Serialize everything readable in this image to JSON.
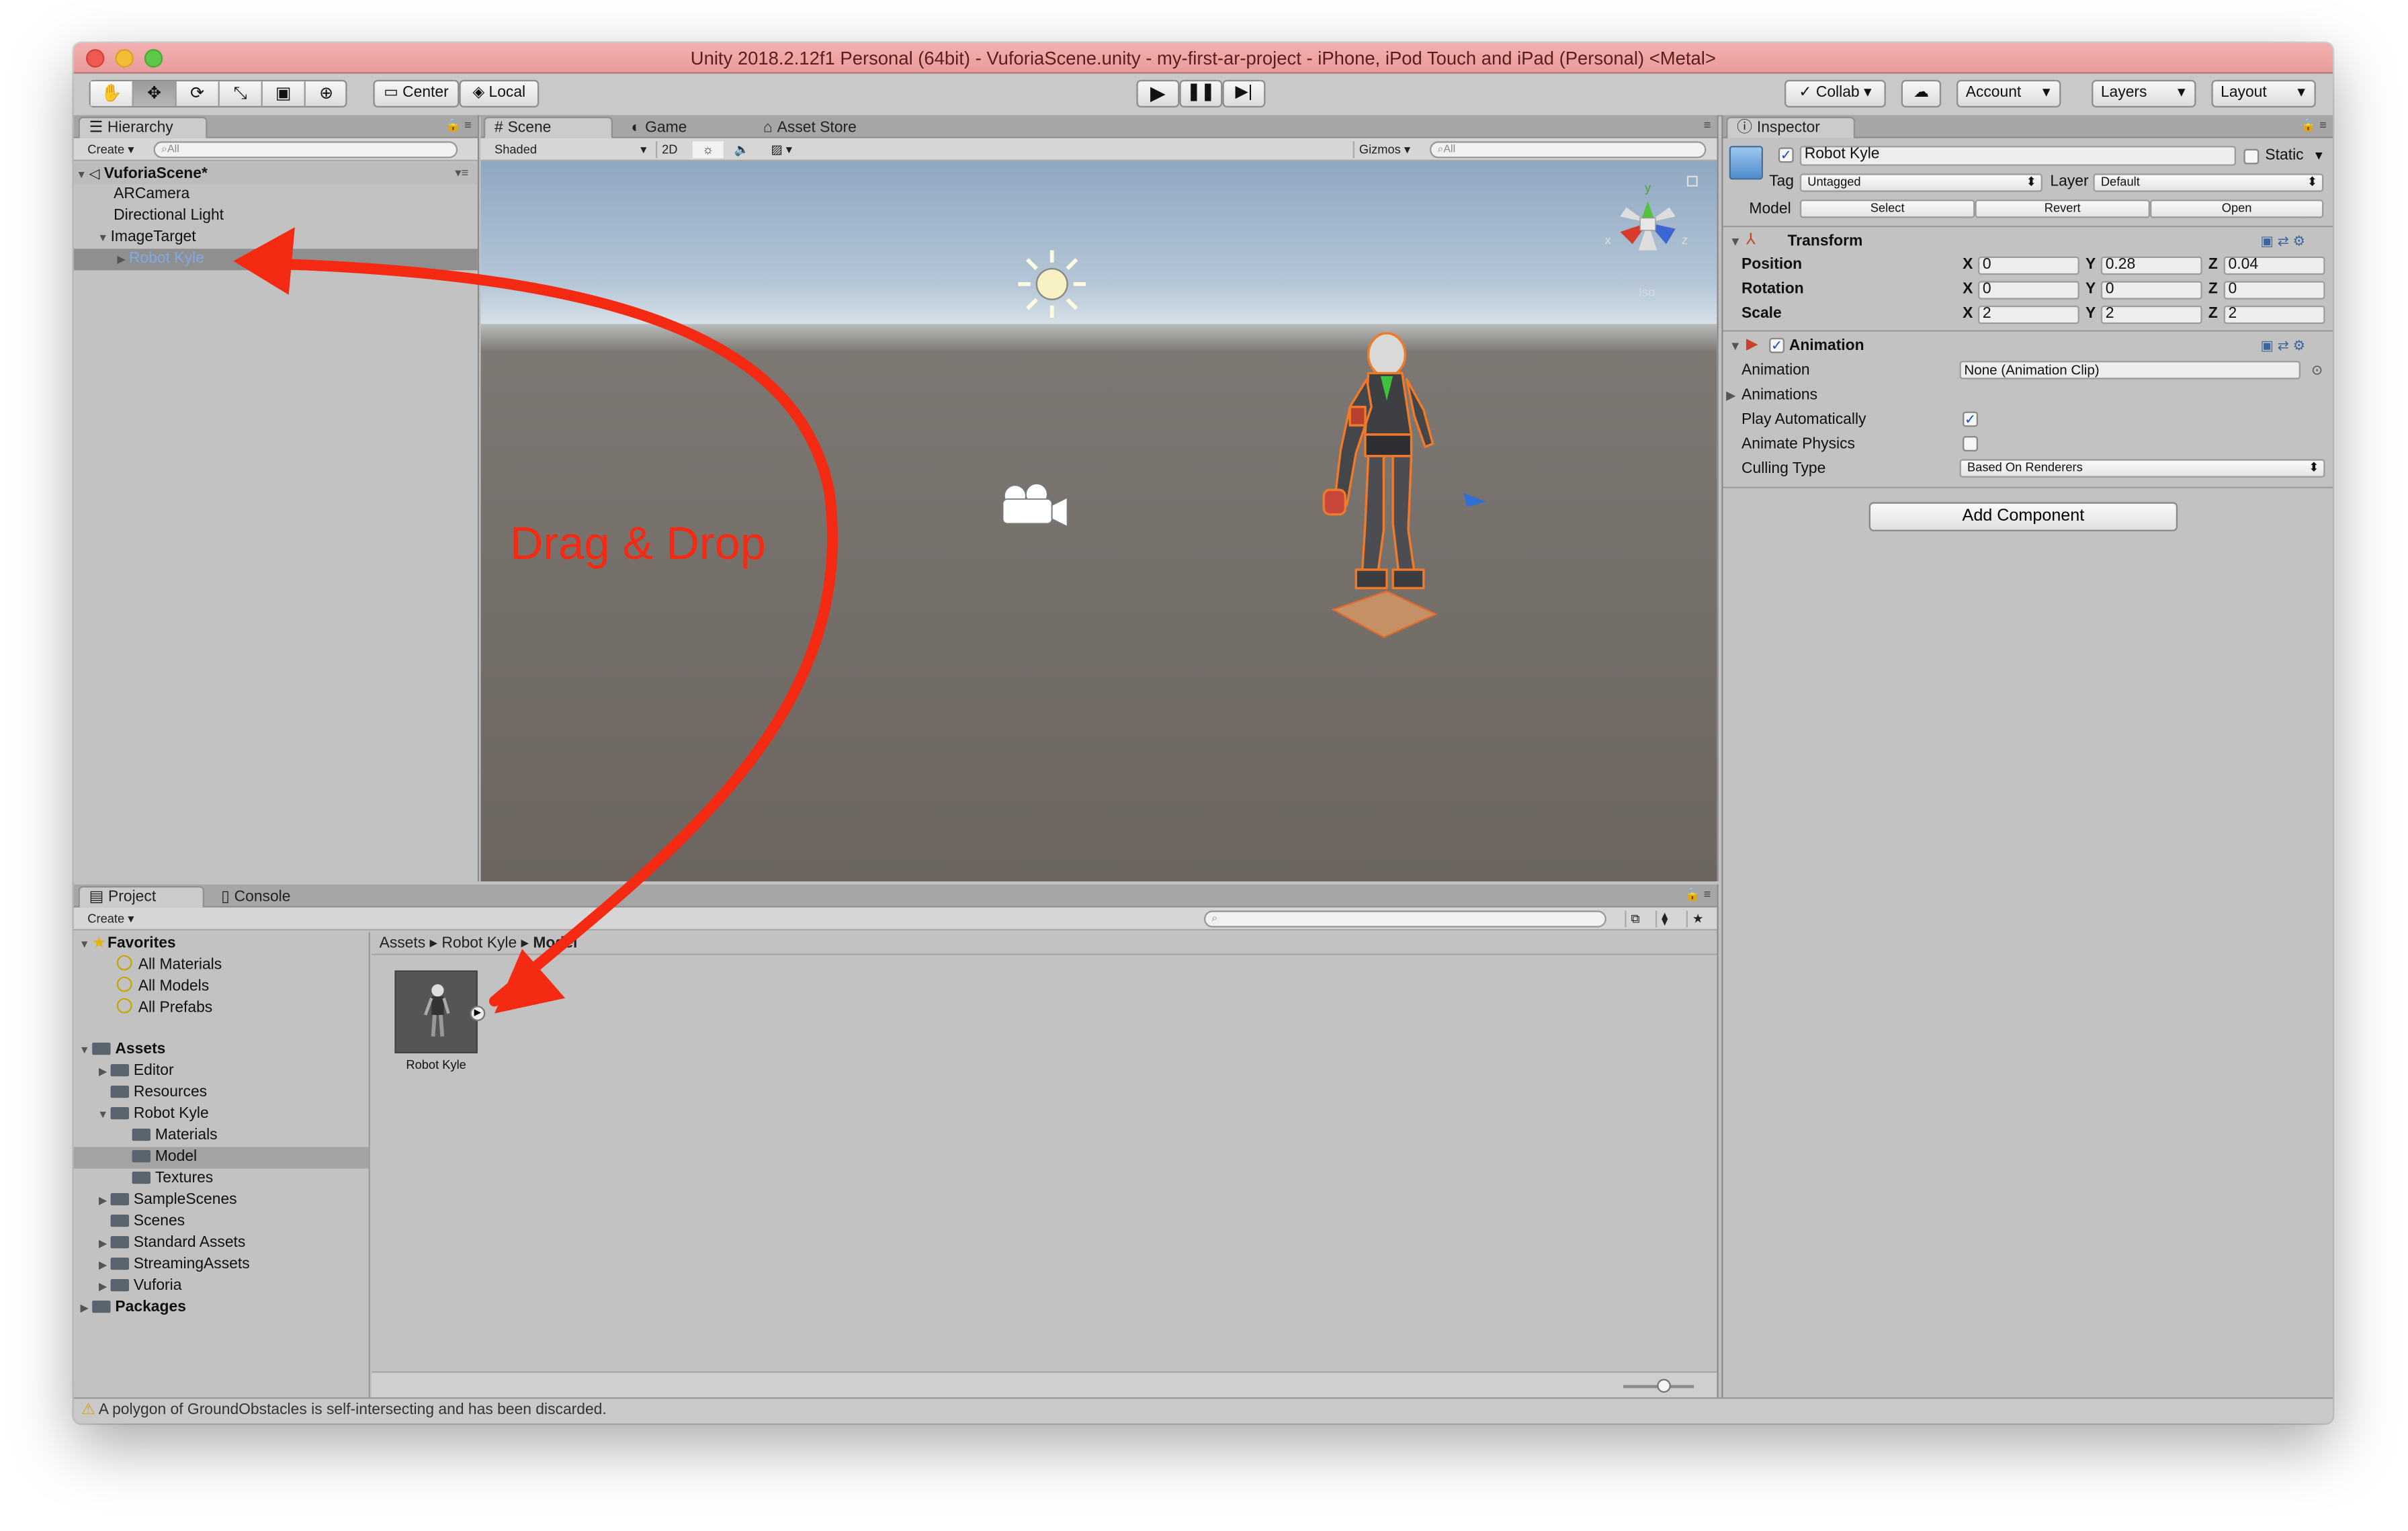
{
  "window": {
    "title": "Unity 2018.2.12f1 Personal (64bit) - VuforiaScene.unity - my-first-ar-project - iPhone, iPod Touch and iPad (Personal) <Metal>"
  },
  "toolbar": {
    "center_label": "Center",
    "local_label": "Local",
    "collab_label": "Collab",
    "account_label": "Account",
    "layers_label": "Layers",
    "layout_label": "Layout"
  },
  "hierarchy": {
    "tab": "Hierarchy",
    "create_label": "Create",
    "search_placeholder": "All",
    "scene_name": "VuforiaScene*",
    "items": [
      {
        "label": "ARCamera"
      },
      {
        "label": "Directional Light"
      },
      {
        "label": "ImageTarget"
      },
      {
        "label": "Robot Kyle"
      }
    ]
  },
  "scene_view": {
    "tabs": [
      "Scene",
      "Game",
      "Asset Store"
    ],
    "shading_mode": "Shaded",
    "mode_2d": "2D",
    "gizmos_label": "Gizmos",
    "search_placeholder": "All",
    "gizmo_axes": {
      "y": "y",
      "x": "x",
      "z": "z"
    },
    "projection_label": "Iso",
    "annotation": "Drag & Drop"
  },
  "inspector": {
    "tab": "Inspector",
    "object_name": "Robot Kyle",
    "static_label": "Static",
    "tag_label": "Tag",
    "tag_value": "Untagged",
    "layer_label": "Layer",
    "layer_value": "Default",
    "model_label": "Model",
    "model_buttons": [
      "Select",
      "Revert",
      "Open"
    ],
    "transform": {
      "title": "Transform",
      "rows": [
        {
          "label": "Position",
          "x": "0",
          "y": "0.28",
          "z": "0.04"
        },
        {
          "label": "Rotation",
          "x": "0",
          "y": "0",
          "z": "0"
        },
        {
          "label": "Scale",
          "x": "2",
          "y": "2",
          "z": "2"
        }
      ]
    },
    "animation": {
      "title": "Animation",
      "animation_label": "Animation",
      "animation_value": "None (Animation Clip)",
      "animations_label": "Animations",
      "play_auto_label": "Play Automatically",
      "play_auto_checked": true,
      "animate_physics_label": "Animate Physics",
      "animate_physics_checked": false,
      "culling_label": "Culling Type",
      "culling_value": "Based On Renderers"
    },
    "add_component_label": "Add Component"
  },
  "project": {
    "tabs": [
      "Project",
      "Console"
    ],
    "create_label": "Create",
    "favorites_label": "Favorites",
    "favorites": [
      "All Materials",
      "All Models",
      "All Prefabs"
    ],
    "assets_label": "Assets",
    "assets_tree": [
      {
        "label": "Editor",
        "level": 1,
        "arrow": true
      },
      {
        "label": "Resources",
        "level": 1,
        "arrow": false
      },
      {
        "label": "Robot Kyle",
        "level": 1,
        "arrow": true,
        "open": true
      },
      {
        "label": "Materials",
        "level": 2,
        "arrow": false
      },
      {
        "label": "Model",
        "level": 2,
        "arrow": false,
        "selected": true
      },
      {
        "label": "Textures",
        "level": 2,
        "arrow": false
      },
      {
        "label": "SampleScenes",
        "level": 1,
        "arrow": true
      },
      {
        "label": "Scenes",
        "level": 1,
        "arrow": false
      },
      {
        "label": "Standard Assets",
        "level": 1,
        "arrow": true
      },
      {
        "label": "StreamingAssets",
        "level": 1,
        "arrow": true
      },
      {
        "label": "Vuforia",
        "level": 1,
        "arrow": true
      }
    ],
    "packages_label": "Packages",
    "breadcrumb": [
      "Assets",
      "Robot Kyle",
      "Model"
    ],
    "asset_label": "Robot Kyle"
  },
  "status_bar": {
    "message": "A polygon of GroundObstacles is self-intersecting and has been discarded."
  },
  "colors": {
    "arrow_red": "#f52a12",
    "title_bar": "#ee9e9e",
    "selection_blue": "#7ea9e8"
  }
}
